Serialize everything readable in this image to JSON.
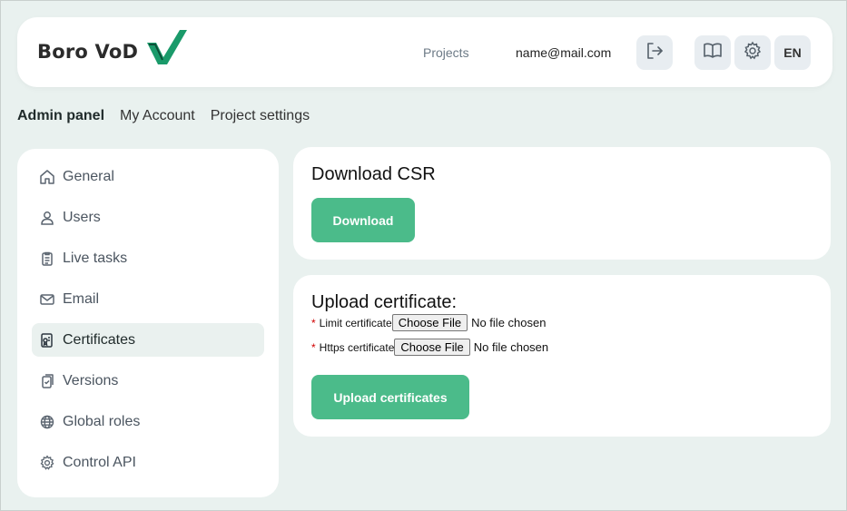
{
  "header": {
    "logo_text": "Boro VoD",
    "nav_projects": "Projects",
    "user_email": "name@mail.com",
    "language": "EN",
    "accent_color": "#1a9a6a"
  },
  "tabs": [
    {
      "label": "Admin panel",
      "active": true
    },
    {
      "label": "My Account",
      "active": false
    },
    {
      "label": "Project settings",
      "active": false
    }
  ],
  "sidebar": {
    "items": [
      {
        "label": "General",
        "icon": "home-icon",
        "active": false
      },
      {
        "label": "Users",
        "icon": "user-icon",
        "active": false
      },
      {
        "label": "Live tasks",
        "icon": "clipboard-icon",
        "active": false
      },
      {
        "label": "Email",
        "icon": "mail-icon",
        "active": false
      },
      {
        "label": "Certificates",
        "icon": "certificate-icon",
        "active": true
      },
      {
        "label": "Versions",
        "icon": "versions-icon",
        "active": false
      },
      {
        "label": "Global roles",
        "icon": "globe-icon",
        "active": false
      },
      {
        "label": "Control API",
        "icon": "gear-icon",
        "active": false
      }
    ]
  },
  "download_csr": {
    "title": "Download CSR",
    "button_label": "Download"
  },
  "upload_certificate": {
    "title": "Upload certificate:",
    "required_mark": "*",
    "limit_label": "Limit certificate",
    "https_label": "Https certificate",
    "choose_file_label": "Choose File",
    "no_file_label": "No file chosen",
    "button_label": "Upload certificates"
  },
  "colors": {
    "button_green": "#4bbb8a",
    "background": "#e9f1ef",
    "required_red": "#d00000"
  }
}
